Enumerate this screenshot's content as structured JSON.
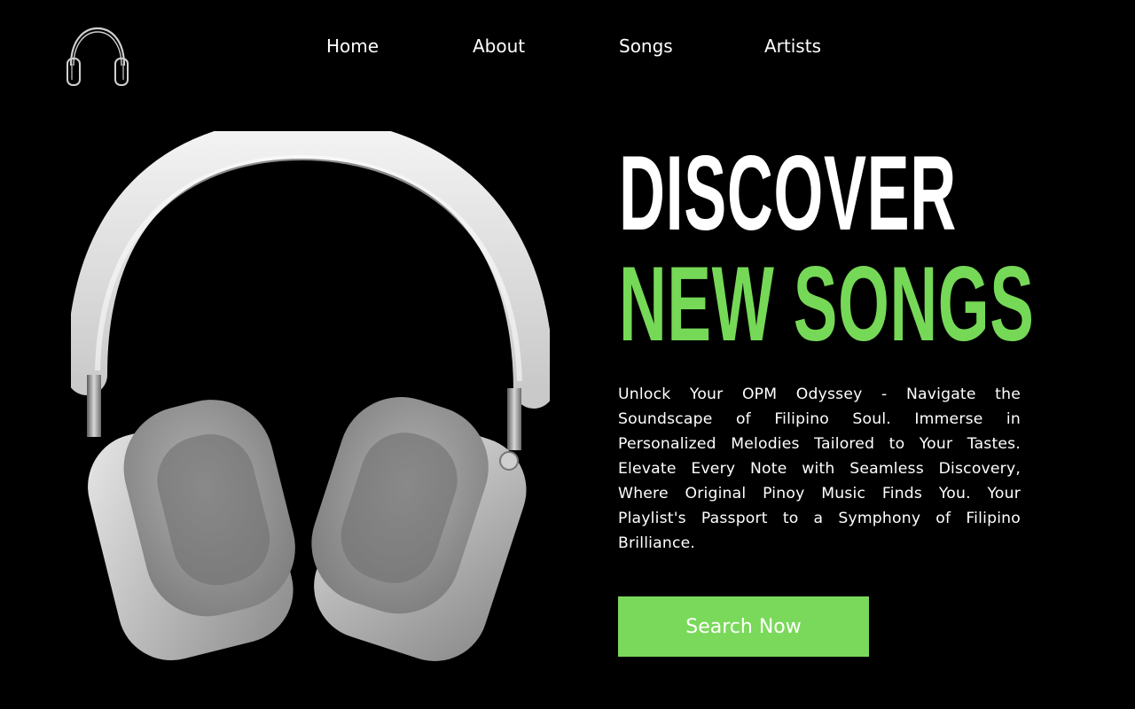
{
  "brand": {
    "logo_icon": "headphones-icon"
  },
  "nav": {
    "items": [
      {
        "label": "Home"
      },
      {
        "label": "About"
      },
      {
        "label": "Songs"
      },
      {
        "label": "Artists"
      }
    ]
  },
  "hero": {
    "headline_line1": "DISCOVER",
    "headline_line2": "NEW SONGS",
    "description": "Unlock Your OPM Odyssey - Navigate the Soundscape of Filipino Soul. Immerse in Personalized Melodies Tailored to Your Tastes. Elevate Every Note with Seamless Discovery, Where Original Pinoy Music Finds You. Your Playlist's Passport to a Symphony of Filipino Brilliance.",
    "cta_label": "Search Now",
    "image_icon": "headphones-product-image"
  },
  "colors": {
    "background": "#000000",
    "text": "#ffffff",
    "accent": "#76d857",
    "button": "#7ad95a"
  }
}
